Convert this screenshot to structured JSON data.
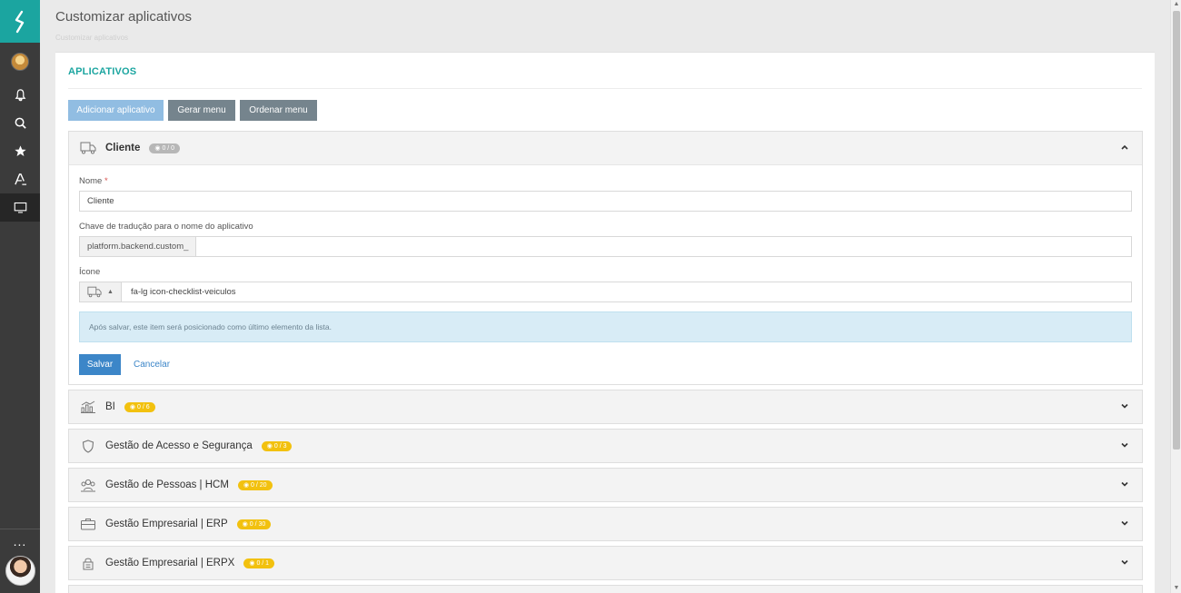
{
  "sidebar": {
    "items": [
      {
        "icon": "bell-icon"
      },
      {
        "icon": "search-icon"
      },
      {
        "icon": "star-icon"
      },
      {
        "icon": "user-search-icon"
      },
      {
        "icon": "monitor-icon",
        "active": true
      }
    ],
    "more_label": "..."
  },
  "header": {
    "title": "Customizar aplicativos",
    "breadcrumb": "Customizar aplicativos"
  },
  "card": {
    "title": "APLICATIVOS",
    "buttons": {
      "add": "Adicionar aplicativo",
      "generate": "Gerar menu",
      "order": "Ordenar menu"
    }
  },
  "expanded_app": {
    "title": "Cliente",
    "badge": "0 / 0",
    "form": {
      "name_label": "Nome",
      "required_mark": "*",
      "name_value": "Cliente",
      "key_label": "Chave de tradução para o nome do aplicativo",
      "key_prefix": "platform.backend.custom_",
      "key_value": "",
      "icon_label": "Ícone",
      "icon_value": "fa-lg icon-checklist-veiculos",
      "info": "Após salvar, este item será posicionado como último elemento da lista.",
      "save": "Salvar",
      "cancel": "Cancelar"
    }
  },
  "apps": [
    {
      "title": "BI",
      "badge": "0 / 6",
      "icon": "chart-icon"
    },
    {
      "title": "Gestão de Acesso e Segurança",
      "badge": "0 / 3",
      "icon": "shield-icon"
    },
    {
      "title": "Gestão de Pessoas | HCM",
      "badge": "0 / 20",
      "icon": "people-icon"
    },
    {
      "title": "Gestão Empresarial | ERP",
      "badge": "0 / 30",
      "icon": "briefcase-icon"
    },
    {
      "title": "Gestão Empresarial | ERPX",
      "badge": "0 / 1",
      "icon": "lock-building-icon"
    }
  ],
  "colors": {
    "brand": "#1ba5a0",
    "sidebar": "#3b3b3b",
    "primary": "#3c86c8",
    "badge_yellow": "#f2c10f"
  }
}
